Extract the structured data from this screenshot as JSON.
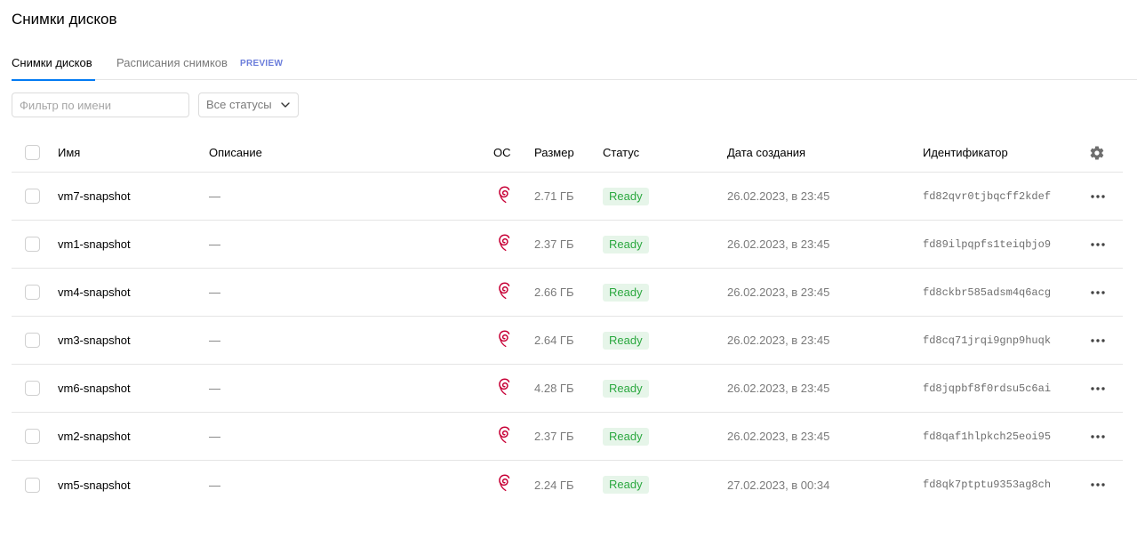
{
  "page": {
    "title": "Снимки дисков"
  },
  "tabs": [
    {
      "label": "Снимки дисков",
      "active": true
    },
    {
      "label": "Расписания снимков",
      "active": false,
      "badge": "PREVIEW"
    }
  ],
  "filters": {
    "name_placeholder": "Фильтр по имени",
    "name_value": "",
    "status_selected": "Все статусы"
  },
  "table": {
    "headers": {
      "name": "Имя",
      "description": "Описание",
      "os": "ОС",
      "size": "Размер",
      "status": "Статус",
      "created": "Дата создания",
      "id": "Идентификатор"
    },
    "rows": [
      {
        "name": "vm7-snapshot",
        "description": "—",
        "os": "debian-icon",
        "size": "2.71 ГБ",
        "status": "Ready",
        "created": "26.02.2023, в 23:45",
        "id": "fd82qvr0tjbqcff2kdef"
      },
      {
        "name": "vm1-snapshot",
        "description": "—",
        "os": "debian-icon",
        "size": "2.37 ГБ",
        "status": "Ready",
        "created": "26.02.2023, в 23:45",
        "id": "fd89ilpqpfs1teiqbjo9"
      },
      {
        "name": "vm4-snapshot",
        "description": "—",
        "os": "debian-icon",
        "size": "2.66 ГБ",
        "status": "Ready",
        "created": "26.02.2023, в 23:45",
        "id": "fd8ckbr585adsm4q6acg"
      },
      {
        "name": "vm3-snapshot",
        "description": "—",
        "os": "debian-icon",
        "size": "2.64 ГБ",
        "status": "Ready",
        "created": "26.02.2023, в 23:45",
        "id": "fd8cq71jrqi9gnp9huqk"
      },
      {
        "name": "vm6-snapshot",
        "description": "—",
        "os": "debian-icon",
        "size": "4.28 ГБ",
        "status": "Ready",
        "created": "26.02.2023, в 23:45",
        "id": "fd8jqpbf8f0rdsu5c6ai"
      },
      {
        "name": "vm2-snapshot",
        "description": "—",
        "os": "debian-icon",
        "size": "2.37 ГБ",
        "status": "Ready",
        "created": "26.02.2023, в 23:45",
        "id": "fd8qaf1hlpkch25eoi95"
      },
      {
        "name": "vm5-snapshot",
        "description": "—",
        "os": "debian-icon",
        "size": "2.24 ГБ",
        "status": "Ready",
        "created": "27.02.2023, в 00:34",
        "id": "fd8qk7ptptu9353ag8ch"
      }
    ]
  },
  "colors": {
    "accent": "#027bf3",
    "ready_text": "#2ba83f",
    "ready_bg": "#e6f5e9",
    "debian_red": "#c70036",
    "preview_badge": "#6b7ddb"
  }
}
